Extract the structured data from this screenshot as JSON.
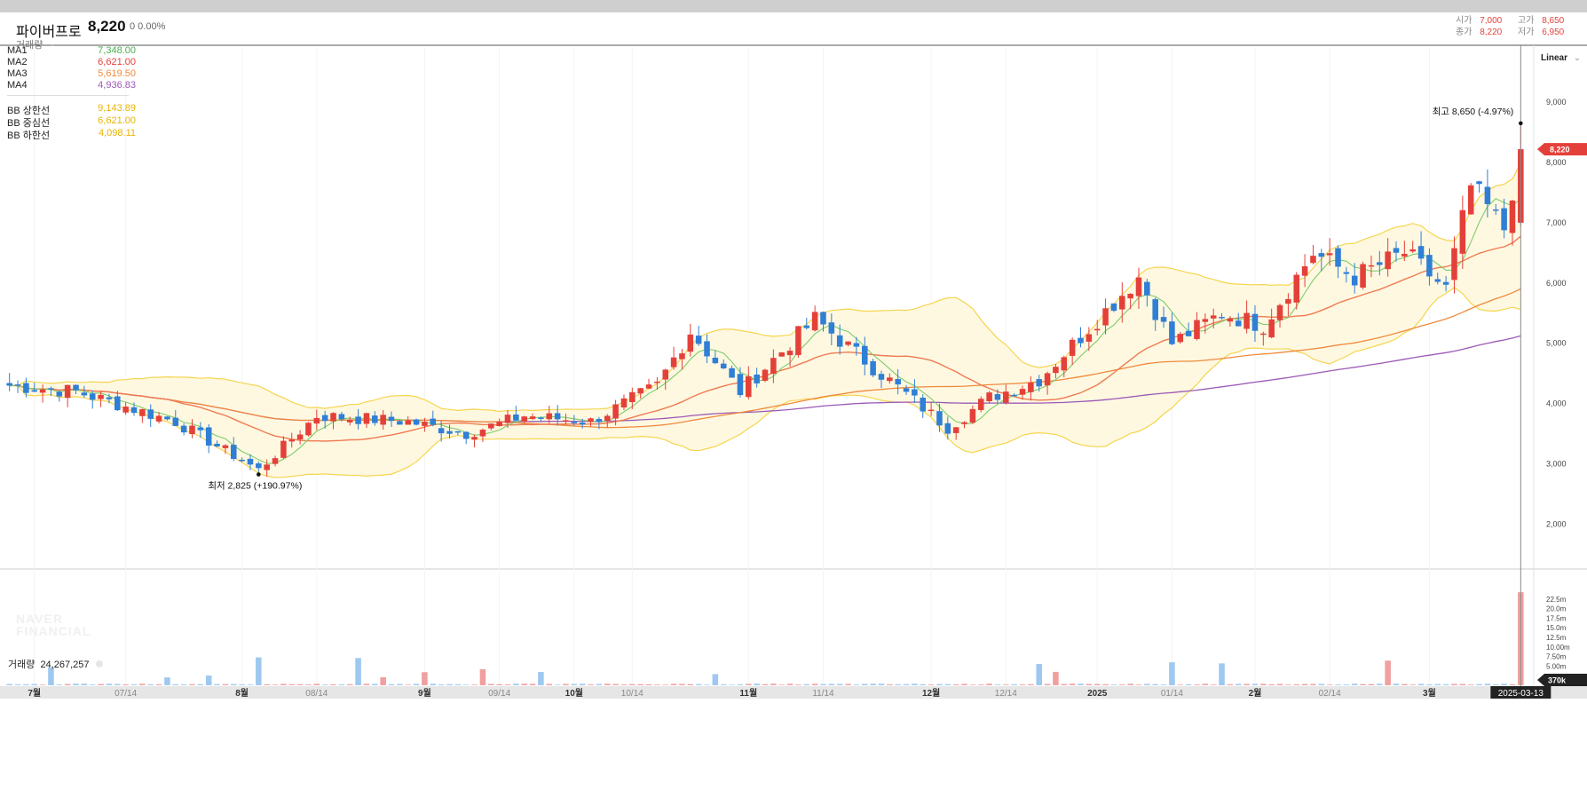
{
  "header": {
    "name": "파이버프로",
    "price": "8,220",
    "change": "0 0.00%",
    "volume_label": "거래량",
    "volume_value": "-",
    "ohlc": {
      "open_label": "시가",
      "open": "7,000",
      "high_label": "고가",
      "high": "8,650",
      "close_label": "종가",
      "close": "8,220",
      "low_label": "저가",
      "low": "6,950"
    }
  },
  "legend": {
    "ma": [
      {
        "label": "MA1",
        "value": "7,348.00",
        "color": "#4caf50"
      },
      {
        "label": "MA2",
        "value": "6,621.00",
        "color": "#e4403a"
      },
      {
        "label": "MA3",
        "value": "5,619.50",
        "color": "#ef8a3c"
      },
      {
        "label": "MA4",
        "value": "4,936.83",
        "color": "#9b59b6"
      }
    ],
    "bb": [
      {
        "label": "BB 상한선",
        "value": "9,143.89",
        "color": "#e8b400"
      },
      {
        "label": "BB 중심선",
        "value": "6,621.00",
        "color": "#e8b400"
      },
      {
        "label": "BB 하한선",
        "value": "4,098.11",
        "color": "#e8b400"
      }
    ]
  },
  "scale_button": "Linear",
  "watermark": [
    "NAVER",
    "FINANCIAL"
  ],
  "current_price_tag": "8,220",
  "crosshair_date": "2025-03-13",
  "volume_panel": {
    "title": "거래량",
    "value": "24,267,257",
    "last_tag": "370k"
  },
  "colors": {
    "up": "#e4403a",
    "down": "#2f7fd6",
    "band_fill": "#fff8e1",
    "band_line": "#f5d54e"
  },
  "chart_data": {
    "type": "candlestick",
    "title": "파이버프로",
    "price_axis": {
      "ticks": [
        2000,
        3000,
        4000,
        5000,
        6000,
        7000,
        8000,
        9000
      ],
      "ylim": [
        1300,
        9900
      ],
      "scale": "linear"
    },
    "volume_axis": {
      "tick_labels": [
        "22.5m",
        "20.0m",
        "17.5m",
        "15.0m",
        "12.5m",
        "10.00m",
        "7.50m",
        "5.00m",
        "2.50m"
      ],
      "ylim": [
        0,
        25000000
      ]
    },
    "x_labels": [
      "7월",
      "07/14",
      "8월",
      "08/14",
      "9월",
      "09/14",
      "10월",
      "10/14",
      "11월",
      "11/14",
      "12월",
      "12/14",
      "2025",
      "01/14",
      "2월",
      "02/14",
      "3월"
    ],
    "x_label_candles": [
      3,
      14,
      28,
      37,
      50,
      59,
      68,
      75,
      89,
      98,
      111,
      120,
      131,
      140,
      150,
      159,
      171
    ],
    "annotations": [
      {
        "label": "최고 8,650 (-4.97%)",
        "candle": 182,
        "price": 8650
      },
      {
        "label": "최저 2,825 (+190.97%)",
        "candle": 30,
        "price": 2825
      }
    ],
    "candles": {
      "count": 183,
      "ma1_last": 7348,
      "ma2_last": 6621,
      "ma3_last": 5619.5,
      "ma4_last": 4936.83,
      "key_points": [
        [
          0,
          4300
        ],
        [
          8,
          4200
        ],
        [
          20,
          3700
        ],
        [
          30,
          2900
        ],
        [
          37,
          3800
        ],
        [
          48,
          3700
        ],
        [
          55,
          3500
        ],
        [
          62,
          3800
        ],
        [
          70,
          3700
        ],
        [
          78,
          4300
        ],
        [
          82,
          5200
        ],
        [
          88,
          4200
        ],
        [
          97,
          5400
        ],
        [
          104,
          4600
        ],
        [
          113,
          3600
        ],
        [
          118,
          4100
        ],
        [
          124,
          4400
        ],
        [
          131,
          5400
        ],
        [
          136,
          6100
        ],
        [
          140,
          5000
        ],
        [
          146,
          5500
        ],
        [
          151,
          5300
        ],
        [
          157,
          6500
        ],
        [
          162,
          6100
        ],
        [
          168,
          6500
        ],
        [
          173,
          5900
        ],
        [
          176,
          7600
        ],
        [
          180,
          6900
        ],
        [
          182,
          8220
        ]
      ],
      "last": {
        "open": 7000,
        "high": 8650,
        "low": 6950,
        "close": 8220
      }
    }
  }
}
